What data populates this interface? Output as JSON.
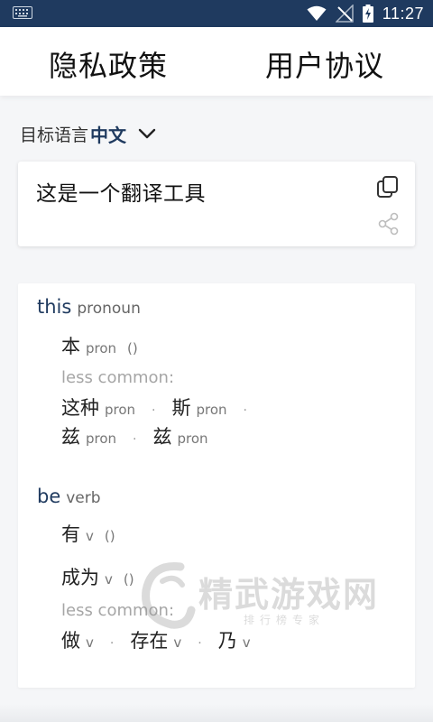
{
  "status_bar": {
    "time": "11:27",
    "icons": [
      "keyboard-icon",
      "wifi-icon",
      "no-signal-icon",
      "battery-charging-icon"
    ]
  },
  "header": {
    "privacy_policy": "隐私政策",
    "user_agreement": "用户协议"
  },
  "language": {
    "label": "目标语言",
    "value": "中文",
    "dropdown_icon": "chevron-down-icon"
  },
  "translation": {
    "text": "这是一个翻译工具",
    "copy_icon": "copy-icon",
    "share_icon": "share-icon"
  },
  "dictionary": {
    "less_common_label": "less common:",
    "separator": "·",
    "entries": [
      {
        "word": "this",
        "pos": "pronoun",
        "translations": [
          {
            "word": "本",
            "pos": "pron",
            "paren": "()"
          }
        ],
        "less_common": [
          [
            {
              "word": "这种",
              "pos": "pron"
            },
            {
              "word": "斯",
              "pos": "pron"
            }
          ],
          [
            {
              "word": "兹",
              "pos": "pron"
            },
            {
              "word": "兹",
              "pos": "pron"
            }
          ]
        ]
      },
      {
        "word": "be",
        "pos": "verb",
        "translations": [
          {
            "word": "有",
            "pos": "v",
            "paren": "()"
          },
          {
            "word": "成为",
            "pos": "v",
            "paren": "()"
          }
        ],
        "less_common": [
          [
            {
              "word": "做",
              "pos": "v"
            },
            {
              "word": "存在",
              "pos": "v"
            },
            {
              "word": "乃",
              "pos": "v"
            }
          ]
        ]
      }
    ]
  },
  "watermark": {
    "title": "精武游戏网",
    "subtitle": "排行榜专家"
  },
  "colors": {
    "status_bar": "#1f3a5f",
    "accent": "#1f3a5f",
    "background": "#f5f6f8"
  }
}
